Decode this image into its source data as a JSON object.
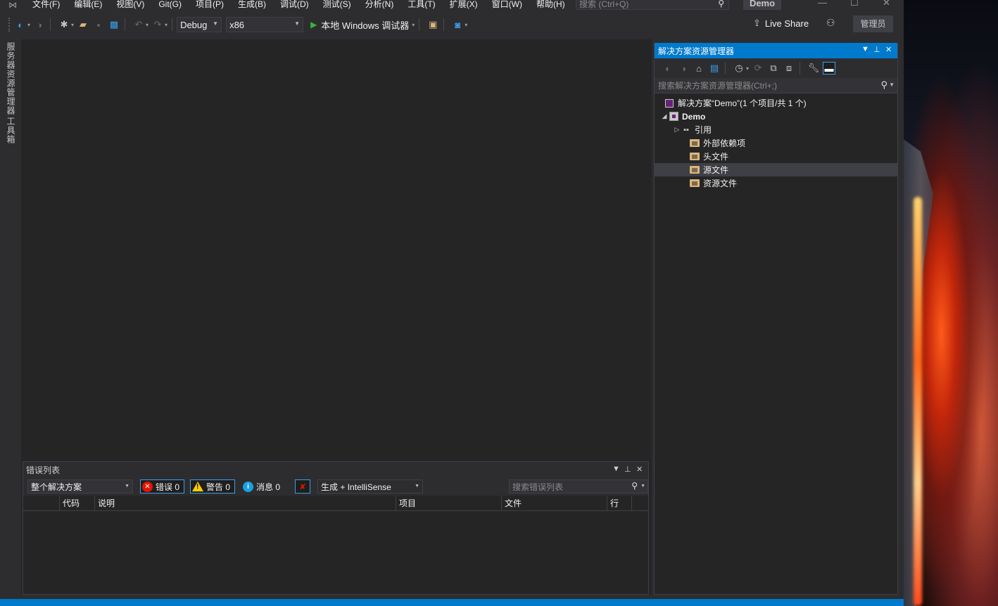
{
  "menu": {
    "items": [
      "文件(F)",
      "编辑(E)",
      "视图(V)",
      "Git(G)",
      "项目(P)",
      "生成(B)",
      "调试(D)",
      "测试(S)",
      "分析(N)",
      "工具(T)",
      "扩展(X)",
      "窗口(W)",
      "帮助(H)"
    ],
    "search_placeholder": "搜索 (Ctrl+Q)",
    "solution_badge": "Demo"
  },
  "toolbar": {
    "config": "Debug",
    "platform": "x86",
    "run_label": "本地 Windows 调试器",
    "live_share": "Live Share",
    "admin": "管理员"
  },
  "left_rail": {
    "tabs": [
      "服务器资源管理器",
      "工具箱"
    ]
  },
  "solution_explorer": {
    "title": "解决方案资源管理器",
    "search_placeholder": "搜索解决方案资源管理器(Ctrl+;)",
    "tree": [
      {
        "label": "解决方案“Demo”(1 个项目/共 1 个)",
        "icon": "solution-icon",
        "level": 0,
        "expander": ""
      },
      {
        "label": "Demo",
        "icon": "cpp-project-icon",
        "level": 0,
        "expander": "◢"
      },
      {
        "label": "引用",
        "icon": "references-icon",
        "level": 1,
        "expander": "▷"
      },
      {
        "label": "外部依赖项",
        "icon": "external-deps-icon",
        "level": 1,
        "expander": ""
      },
      {
        "label": "头文件",
        "icon": "filter-folder-icon",
        "level": 1,
        "expander": ""
      },
      {
        "label": "源文件",
        "icon": "filter-folder-icon",
        "level": 1,
        "expander": "",
        "selected": true
      },
      {
        "label": "资源文件",
        "icon": "filter-folder-icon",
        "level": 1,
        "expander": ""
      }
    ]
  },
  "error_list": {
    "title": "错误列表",
    "scope": "整个解决方案",
    "errors_label": "错误 0",
    "warnings_label": "警告 0",
    "messages_label": "消息 0",
    "build_filter": "生成 + IntelliSense",
    "search_placeholder": "搜索错误列表",
    "columns": [
      "代码",
      "说明",
      "项目",
      "文件",
      "行"
    ]
  },
  "colors": {
    "accent": "#007acc",
    "background": "#2d2d30",
    "panel": "#252526"
  }
}
